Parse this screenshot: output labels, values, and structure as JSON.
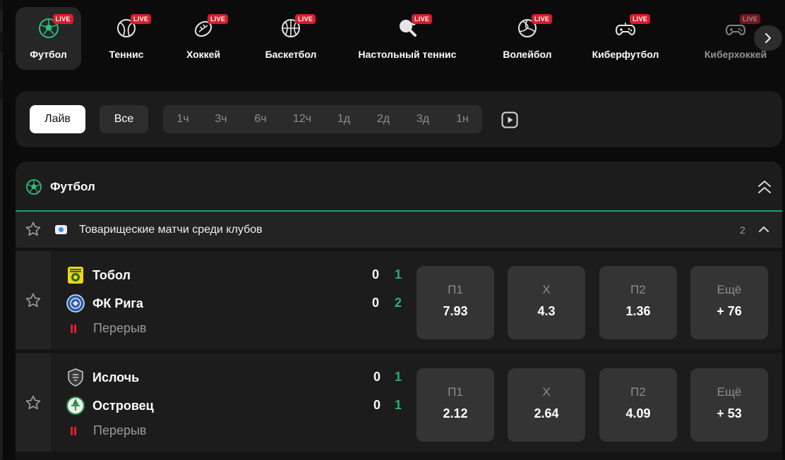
{
  "sports": [
    {
      "label": "Футбол",
      "badge": "LIVE",
      "icon": "football-icon",
      "active": true
    },
    {
      "label": "Теннис",
      "badge": "LIVE",
      "icon": "tennis-icon"
    },
    {
      "label": "Хоккей",
      "badge": "LIVE",
      "icon": "hockey-icon"
    },
    {
      "label": "Баскетбол",
      "badge": "LIVE",
      "icon": "basketball-icon"
    },
    {
      "label": "Настольный теннис",
      "badge": "LIVE",
      "icon": "table-tennis-icon"
    },
    {
      "label": "Волейбол",
      "badge": "LIVE",
      "icon": "volleyball-icon"
    },
    {
      "label": "Киберфутбол",
      "badge": "LIVE",
      "icon": "gamepad-icon"
    },
    {
      "label": "Киберхоккей",
      "badge": "LIVE",
      "icon": "gamepad-icon"
    }
  ],
  "filters": {
    "live": "Лайв",
    "all": "Все",
    "ranges": [
      "1ч",
      "3ч",
      "6ч",
      "12ч",
      "1д",
      "2д",
      "3д",
      "1н"
    ]
  },
  "section": {
    "title": "Футбол",
    "league": {
      "name": "Товарищеские матчи среди клубов",
      "count": "2"
    }
  },
  "matches": [
    {
      "team1": {
        "name": "Тобол",
        "score_a": "0",
        "score_b": "1"
      },
      "team2": {
        "name": "ФК Рига",
        "score_a": "0",
        "score_b": "2"
      },
      "status": "Перерыв",
      "odds": [
        {
          "label": "П1",
          "value": "7.93"
        },
        {
          "label": "Х",
          "value": "4.3"
        },
        {
          "label": "П2",
          "value": "1.36"
        },
        {
          "label": "Ещё",
          "value": "+ 76"
        }
      ]
    },
    {
      "team1": {
        "name": "Ислочь",
        "score_a": "0",
        "score_b": "1"
      },
      "team2": {
        "name": "Островец",
        "score_a": "0",
        "score_b": "1"
      },
      "status": "Перерыв",
      "odds": [
        {
          "label": "П1",
          "value": "2.12"
        },
        {
          "label": "Х",
          "value": "2.64"
        },
        {
          "label": "П2",
          "value": "4.09"
        },
        {
          "label": "Ещё",
          "value": "+ 53"
        }
      ]
    }
  ],
  "colors": {
    "live_badge": "#d61f2c",
    "accent_green": "#22b36f",
    "pause_red": "#e31c2c"
  }
}
